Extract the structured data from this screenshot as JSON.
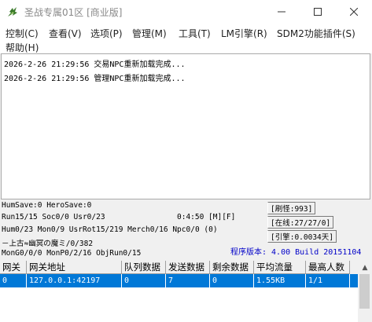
{
  "window": {
    "title": "圣战专属01区 [商业版]"
  },
  "menu": [
    "控制(C)",
    "查看(V)",
    "选项(P)",
    "管理(M)",
    "工具(T)",
    "LM引擎(R)",
    "SDM2功能插件(S)",
    "帮助(H)"
  ],
  "log": [
    "2026-2-26 21:29:56 交易NPC重新加载完成...",
    "2026-2-26 21:29:56 管理NPC重新加载完成..."
  ],
  "stats": {
    "line1": "HumSave:0 HeroSave:0",
    "line2": "Run15/15 Soc0/0 Usr0/23",
    "time": "0:4:50 [M][F]",
    "line3": "Hum0/23 Mon0/9 UsrRot15/219 Merch0/16 Npc0/0 (0)",
    "line4": "－上古≈幽冥の魔ミ/0/382",
    "line5": "MonG0/0/0 MonP0/2/16 ObjRun0/15",
    "refresh": "[刷怪:993]",
    "online": "[在线:27/27/0]",
    "engine": "[引擎:0.0034天]",
    "version": "程序版本: 4.00 Build 20151104"
  },
  "grid": {
    "headers": [
      "网关",
      "网关地址",
      "队列数据",
      "发送数据",
      "剩余数据",
      "平均流量",
      "最高人数"
    ],
    "rows": [
      [
        "0",
        "127.0.0.1:42197",
        "0",
        "7",
        "0",
        "1.55KB",
        "1/1"
      ]
    ]
  },
  "colors": {
    "selection": "#0078d7",
    "version_text": "#0000c8"
  }
}
